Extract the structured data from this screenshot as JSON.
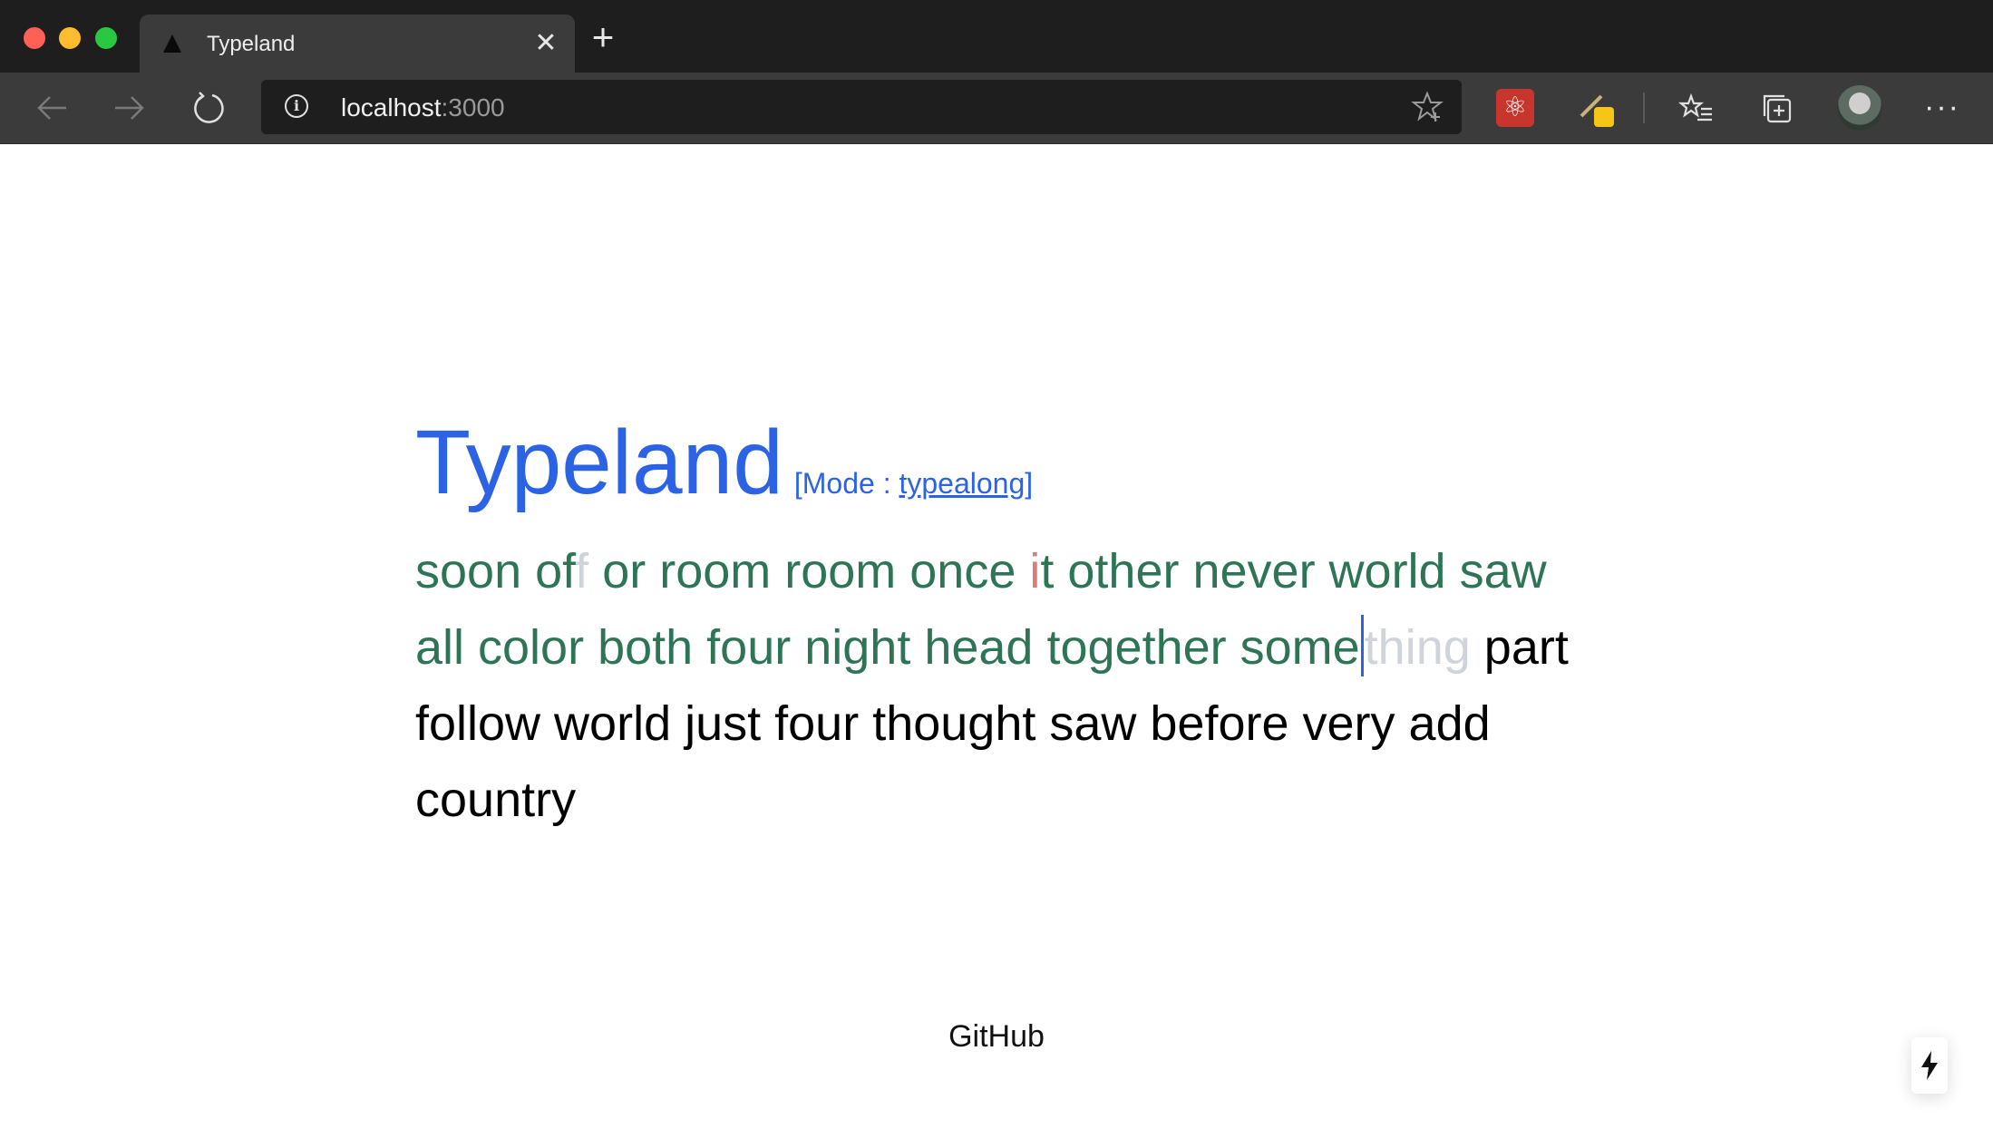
{
  "browser": {
    "tab": {
      "title": "Typeland",
      "close_icon": "close-icon",
      "favicon": "triangle-icon"
    },
    "new_tab_icon": "plus-icon",
    "address": {
      "host": "localhost",
      "port": ":3000"
    },
    "toolbar_icons": [
      "back-icon",
      "forward-icon",
      "refresh-icon",
      "info-icon",
      "favorite-star-icon",
      "react-devtools-icon",
      "pen-extension-icon",
      "favorites-icon",
      "collections-icon",
      "profile-avatar",
      "more-icon"
    ]
  },
  "page": {
    "title": "Typeland",
    "mode_prefix": "[Mode : ",
    "mode_value": "typealong",
    "mode_suffix": "]",
    "text": {
      "typed_1": "soon of",
      "pending_1": "f",
      "typed_2": " or room room once ",
      "error_1": "i",
      "typed_3": "t other never world saw all color both four night head together some",
      "pending_2": "thing",
      "remaining": " part follow world just four thought saw before very add country"
    },
    "footer_link": "GitHub",
    "floating_button_icon": "lightning-icon"
  }
}
